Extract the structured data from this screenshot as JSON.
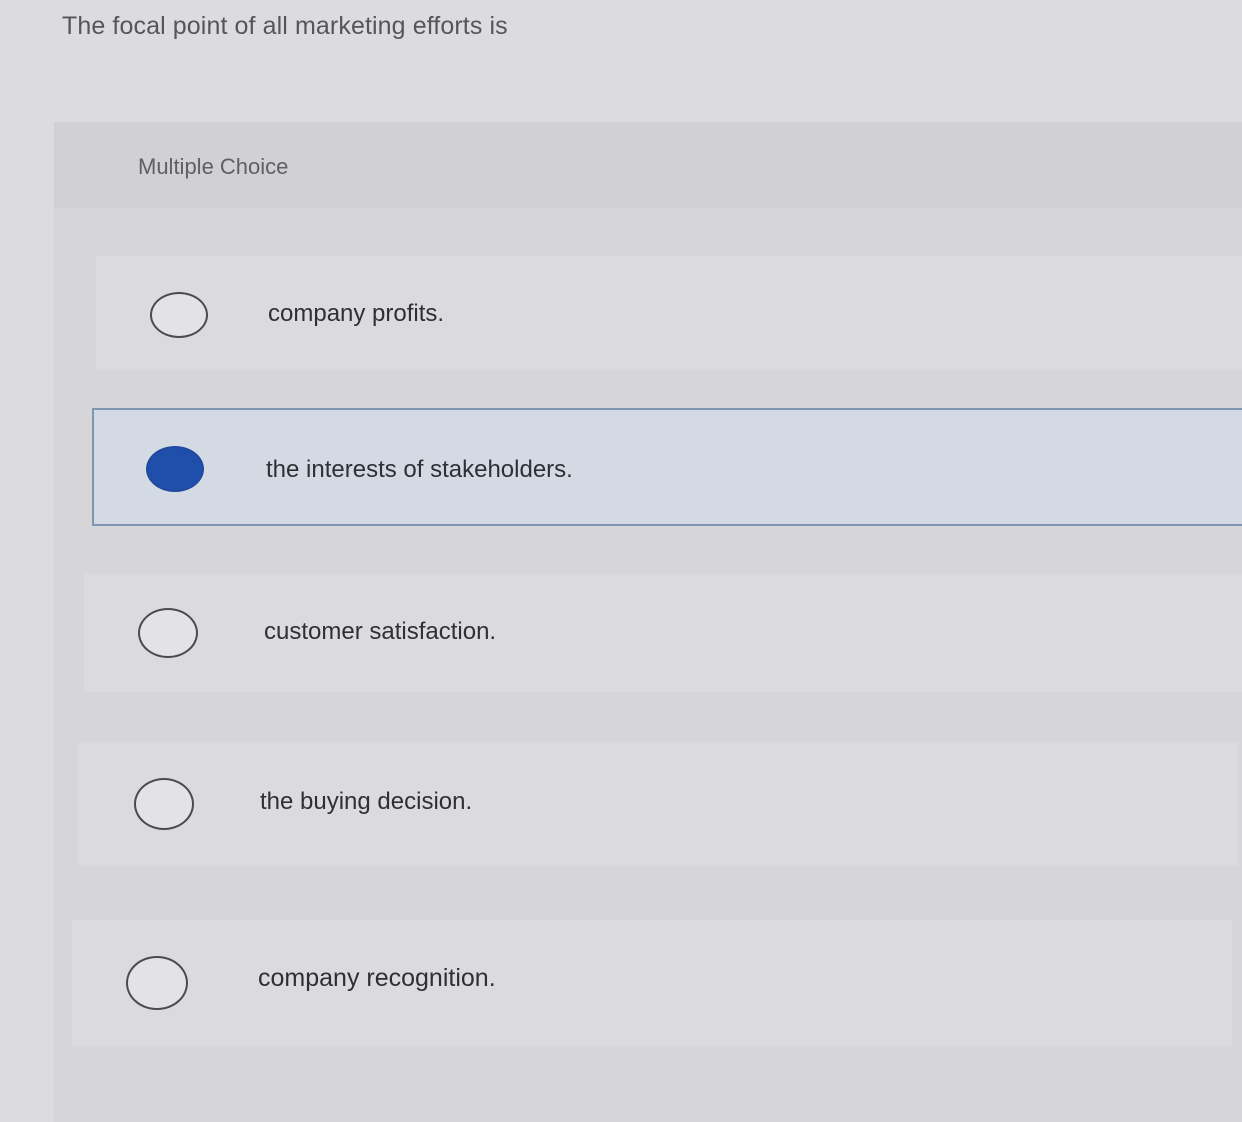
{
  "question": {
    "text": "The focal point of all marketing efforts is"
  },
  "question_type": "Multiple Choice",
  "options": [
    {
      "label": "company profits.",
      "selected": false
    },
    {
      "label": "the interests of stakeholders.",
      "selected": true
    },
    {
      "label": "customer satisfaction.",
      "selected": false
    },
    {
      "label": "the buying decision.",
      "selected": false
    },
    {
      "label": "company recognition.",
      "selected": false
    }
  ],
  "colors": {
    "selected_radio": "#1f4faa",
    "selected_background": "#d3dae4",
    "selected_border": "#7f96b3"
  }
}
